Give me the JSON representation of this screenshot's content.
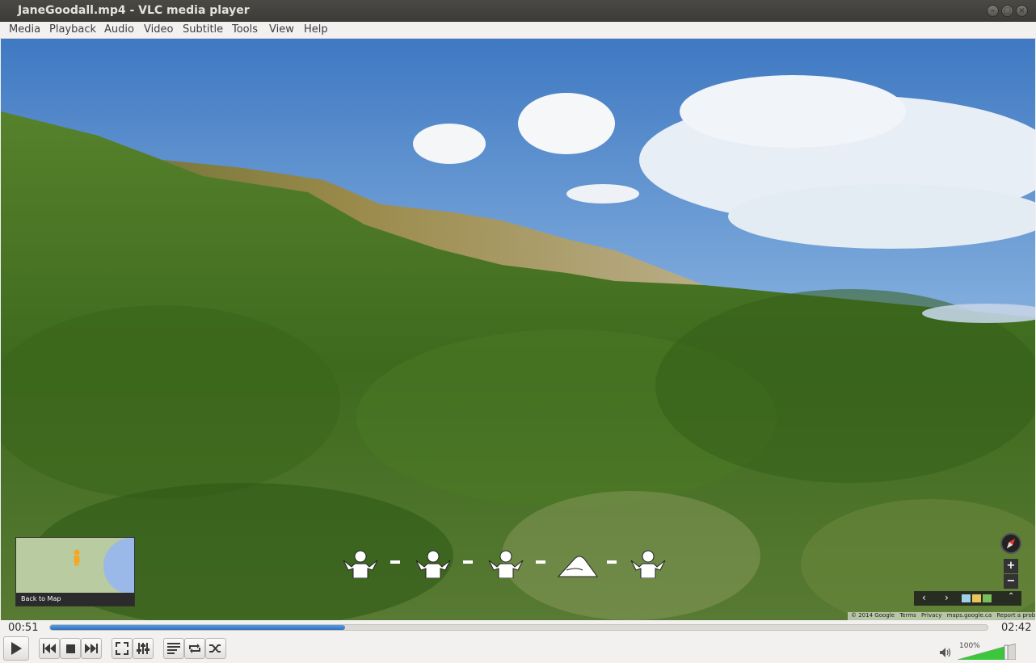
{
  "window": {
    "title": "JaneGoodall.mp4 - VLC media player",
    "controls": [
      "minimize-icon",
      "maximize-icon",
      "close-icon"
    ]
  },
  "menu": {
    "items": [
      {
        "label": "Media"
      },
      {
        "label": "Playback"
      },
      {
        "label": "Audio"
      },
      {
        "label": "Video"
      },
      {
        "label": "Subtitle"
      },
      {
        "label": "Tools"
      },
      {
        "label": "View"
      },
      {
        "label": "Help"
      }
    ]
  },
  "video": {
    "overlay": {
      "minimap_link": "Back to Map",
      "credits": {
        "copyright": "© 2014 Google",
        "terms": "Terms",
        "privacy": "Privacy",
        "site": "maps.google.ca",
        "report": "Report a problem"
      }
    }
  },
  "playback": {
    "elapsed": "00:51",
    "total": "02:42",
    "progress": 0.315
  },
  "volume": {
    "label": "100%",
    "level": 1.0
  },
  "colors": {
    "accent": "#2f6fc0",
    "volume": "#3cc63c"
  }
}
